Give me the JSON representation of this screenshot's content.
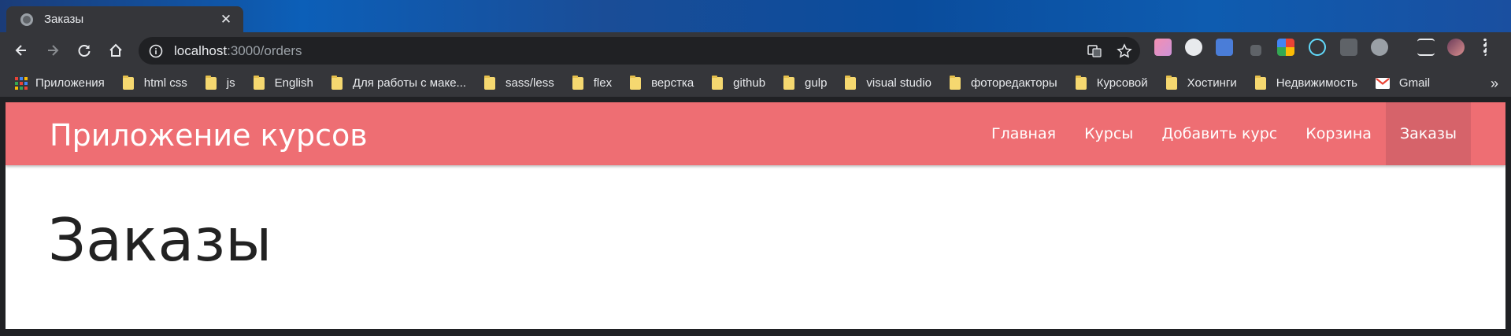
{
  "browser": {
    "tab": {
      "title": "Заказы",
      "close_glyph": "✕"
    },
    "omnibox": {
      "host": "localhost",
      "path": ":3000/orders"
    },
    "bookmarks": {
      "apps_label": "Приложения",
      "folders": [
        "html css",
        "js",
        "English",
        "Для работы с маке...",
        "sass/less",
        "flex",
        "верстка",
        "github",
        "gulp",
        "visual studio",
        "фоторедакторы",
        "Курсовой",
        "Хостинги",
        "Недвижимость"
      ],
      "gmail_label": "Gmail",
      "more_glyph": "»"
    }
  },
  "colors": {
    "navbar": "#ee6e73",
    "navbar_active": "#d6636a",
    "page_bg": "#ffffff"
  },
  "app": {
    "brand": "Приложение курсов",
    "nav": [
      "Главная",
      "Курсы",
      "Добавить курс",
      "Корзина",
      "Заказы"
    ],
    "active_nav": "Заказы",
    "page_title": "Заказы"
  }
}
